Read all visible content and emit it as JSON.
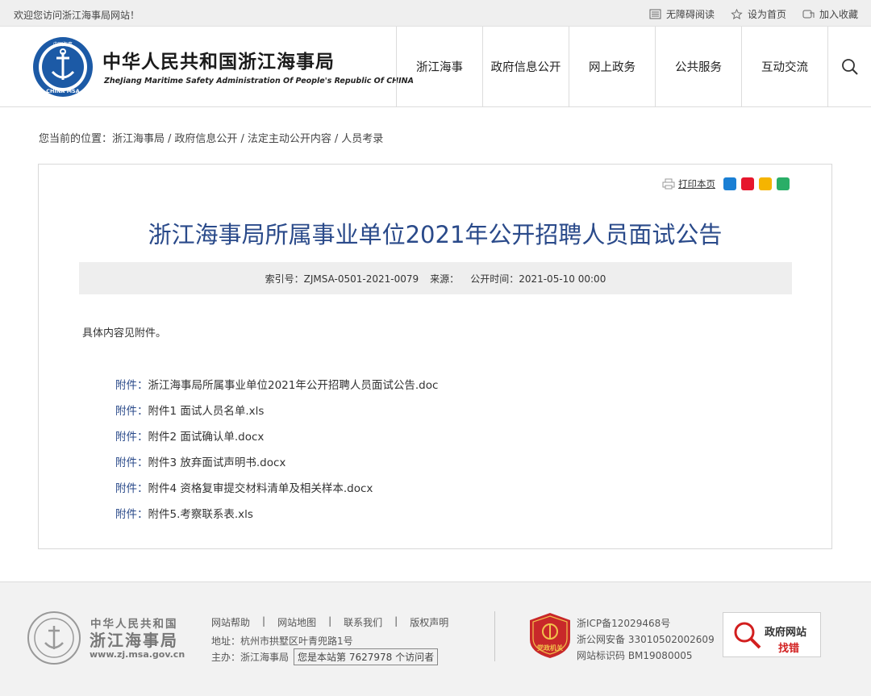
{
  "topbar": {
    "welcome": "欢迎您访问浙江海事局网站！",
    "links": [
      {
        "label": "无障碍阅读",
        "icon": "accessibility-icon"
      },
      {
        "label": "设为首页",
        "icon": "star-icon"
      },
      {
        "label": "加入收藏",
        "icon": "bookmark-icon"
      }
    ]
  },
  "header": {
    "logo_text": "CHINA MSA",
    "logo_top": "中国海事",
    "brand_cn": "中华人民共和国浙江海事局",
    "brand_en": "ZheJiang Maritime Safety Administration Of People's Republic Of CHINA",
    "nav": [
      "浙江海事",
      "政府信息公开",
      "网上政务",
      "公共服务",
      "互动交流"
    ]
  },
  "breadcrumb": {
    "prefix": "您当前的位置：",
    "items": [
      "浙江海事局",
      "政府信息公开",
      "法定主动公开内容",
      "人员考录"
    ],
    "separator": "/"
  },
  "article": {
    "print_label": "打印本页",
    "share_icons": [
      {
        "name": "qq-share-icon",
        "color": "#1a7fd4"
      },
      {
        "name": "weibo-share-icon",
        "color": "#e6162d"
      },
      {
        "name": "qzone-share-icon",
        "color": "#f5b400"
      },
      {
        "name": "wechat-share-icon",
        "color": "#2aae67"
      }
    ],
    "title": "浙江海事局所属事业单位2021年公开招聘人员面试公告",
    "meta": {
      "index": "索引号：ZJMSA-0501-2021-0079",
      "source": "来源：",
      "time": "公开时间：2021-05-10 00:00"
    },
    "body": "具体内容见附件。",
    "attachment_prefix": "附件：",
    "attachments": [
      "浙江海事局所属事业单位2021年公开招聘人员面试公告.doc",
      "附件1 面试人员名单.xls",
      "附件2 面试确认单.docx",
      "附件3 放弃面试声明书.docx",
      "附件4 资格复审提交材料清单及相关样本.docx",
      "附件5.考察联系表.xls"
    ]
  },
  "footer": {
    "cn1": "中华人民共和国",
    "cn2": "浙江海事局",
    "url": "www.zj.msa.gov.cn",
    "links": [
      "网站帮助",
      "网站地图",
      "联系我们",
      "版权声明"
    ],
    "address": "地址：杭州市拱墅区叶青兜路1号",
    "host": "主办：浙江海事局",
    "counter": "您是本站第 7627978 个访问者",
    "badge_text": "党政机关",
    "icp": "浙ICP备12029468号",
    "police": "浙公网安备 33010502002609",
    "site_id": "网站标识码 BM19080005",
    "find_error_t1": "政府网站",
    "find_error_t2": "找错"
  }
}
